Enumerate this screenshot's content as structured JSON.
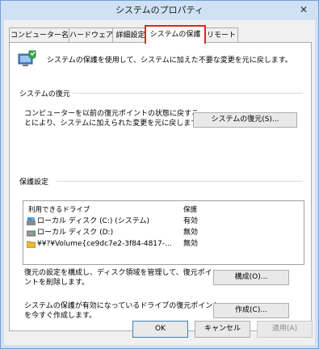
{
  "window": {
    "title": "システムのプロパティ",
    "close_glyph": "✕"
  },
  "tabs": [
    {
      "label": "コンピューター名",
      "active": false
    },
    {
      "label": "ハードウェア",
      "active": false
    },
    {
      "label": "詳細設定",
      "active": false
    },
    {
      "label": "システムの保護",
      "active": true
    },
    {
      "label": "リモート",
      "active": false
    }
  ],
  "intro": {
    "icon": "system-protection-icon",
    "text": "システムの保護を使用して、システムに加えた不要な変更を元に戻します。"
  },
  "restore": {
    "group_label": "システムの復元",
    "desc_line1": "コンピューターを以前の復元ポイントの状態に戻すこ",
    "desc_line2": "とにより、システムに加えられた変更を元に戻します。",
    "button": "システムの復元(S)..."
  },
  "protection": {
    "group_label": "保護設定",
    "col_drive": "利用できるドライブ",
    "col_protection": "保護",
    "drives": [
      {
        "name": "ローカル ディスク (C:) (システム)",
        "status": "有効",
        "icon": "system-drive-icon"
      },
      {
        "name": "ローカル ディスク (D:)",
        "status": "無効",
        "icon": "drive-icon"
      },
      {
        "name": "¥¥?¥Volume{ce9dc7e2-3f84-4817-...",
        "status": "無効",
        "icon": "folder-icon"
      }
    ],
    "configure_desc_line1": "復元の設定を構成し、ディスク領域を管理して、復元ポイ",
    "configure_desc_line2": "ントを削除します。",
    "configure_button": "構成(O)...",
    "create_desc_line1": "システムの保護が有効になっているドライブの復元ポイント",
    "create_desc_line2": "を今すぐ作成します。",
    "create_button": "作成(C)..."
  },
  "footer": {
    "ok": "OK",
    "cancel": "キャンセル",
    "apply": "適用(A)"
  },
  "colors": {
    "active_tab_border": "#e8202a",
    "titlebar": "#cfe1f3"
  }
}
